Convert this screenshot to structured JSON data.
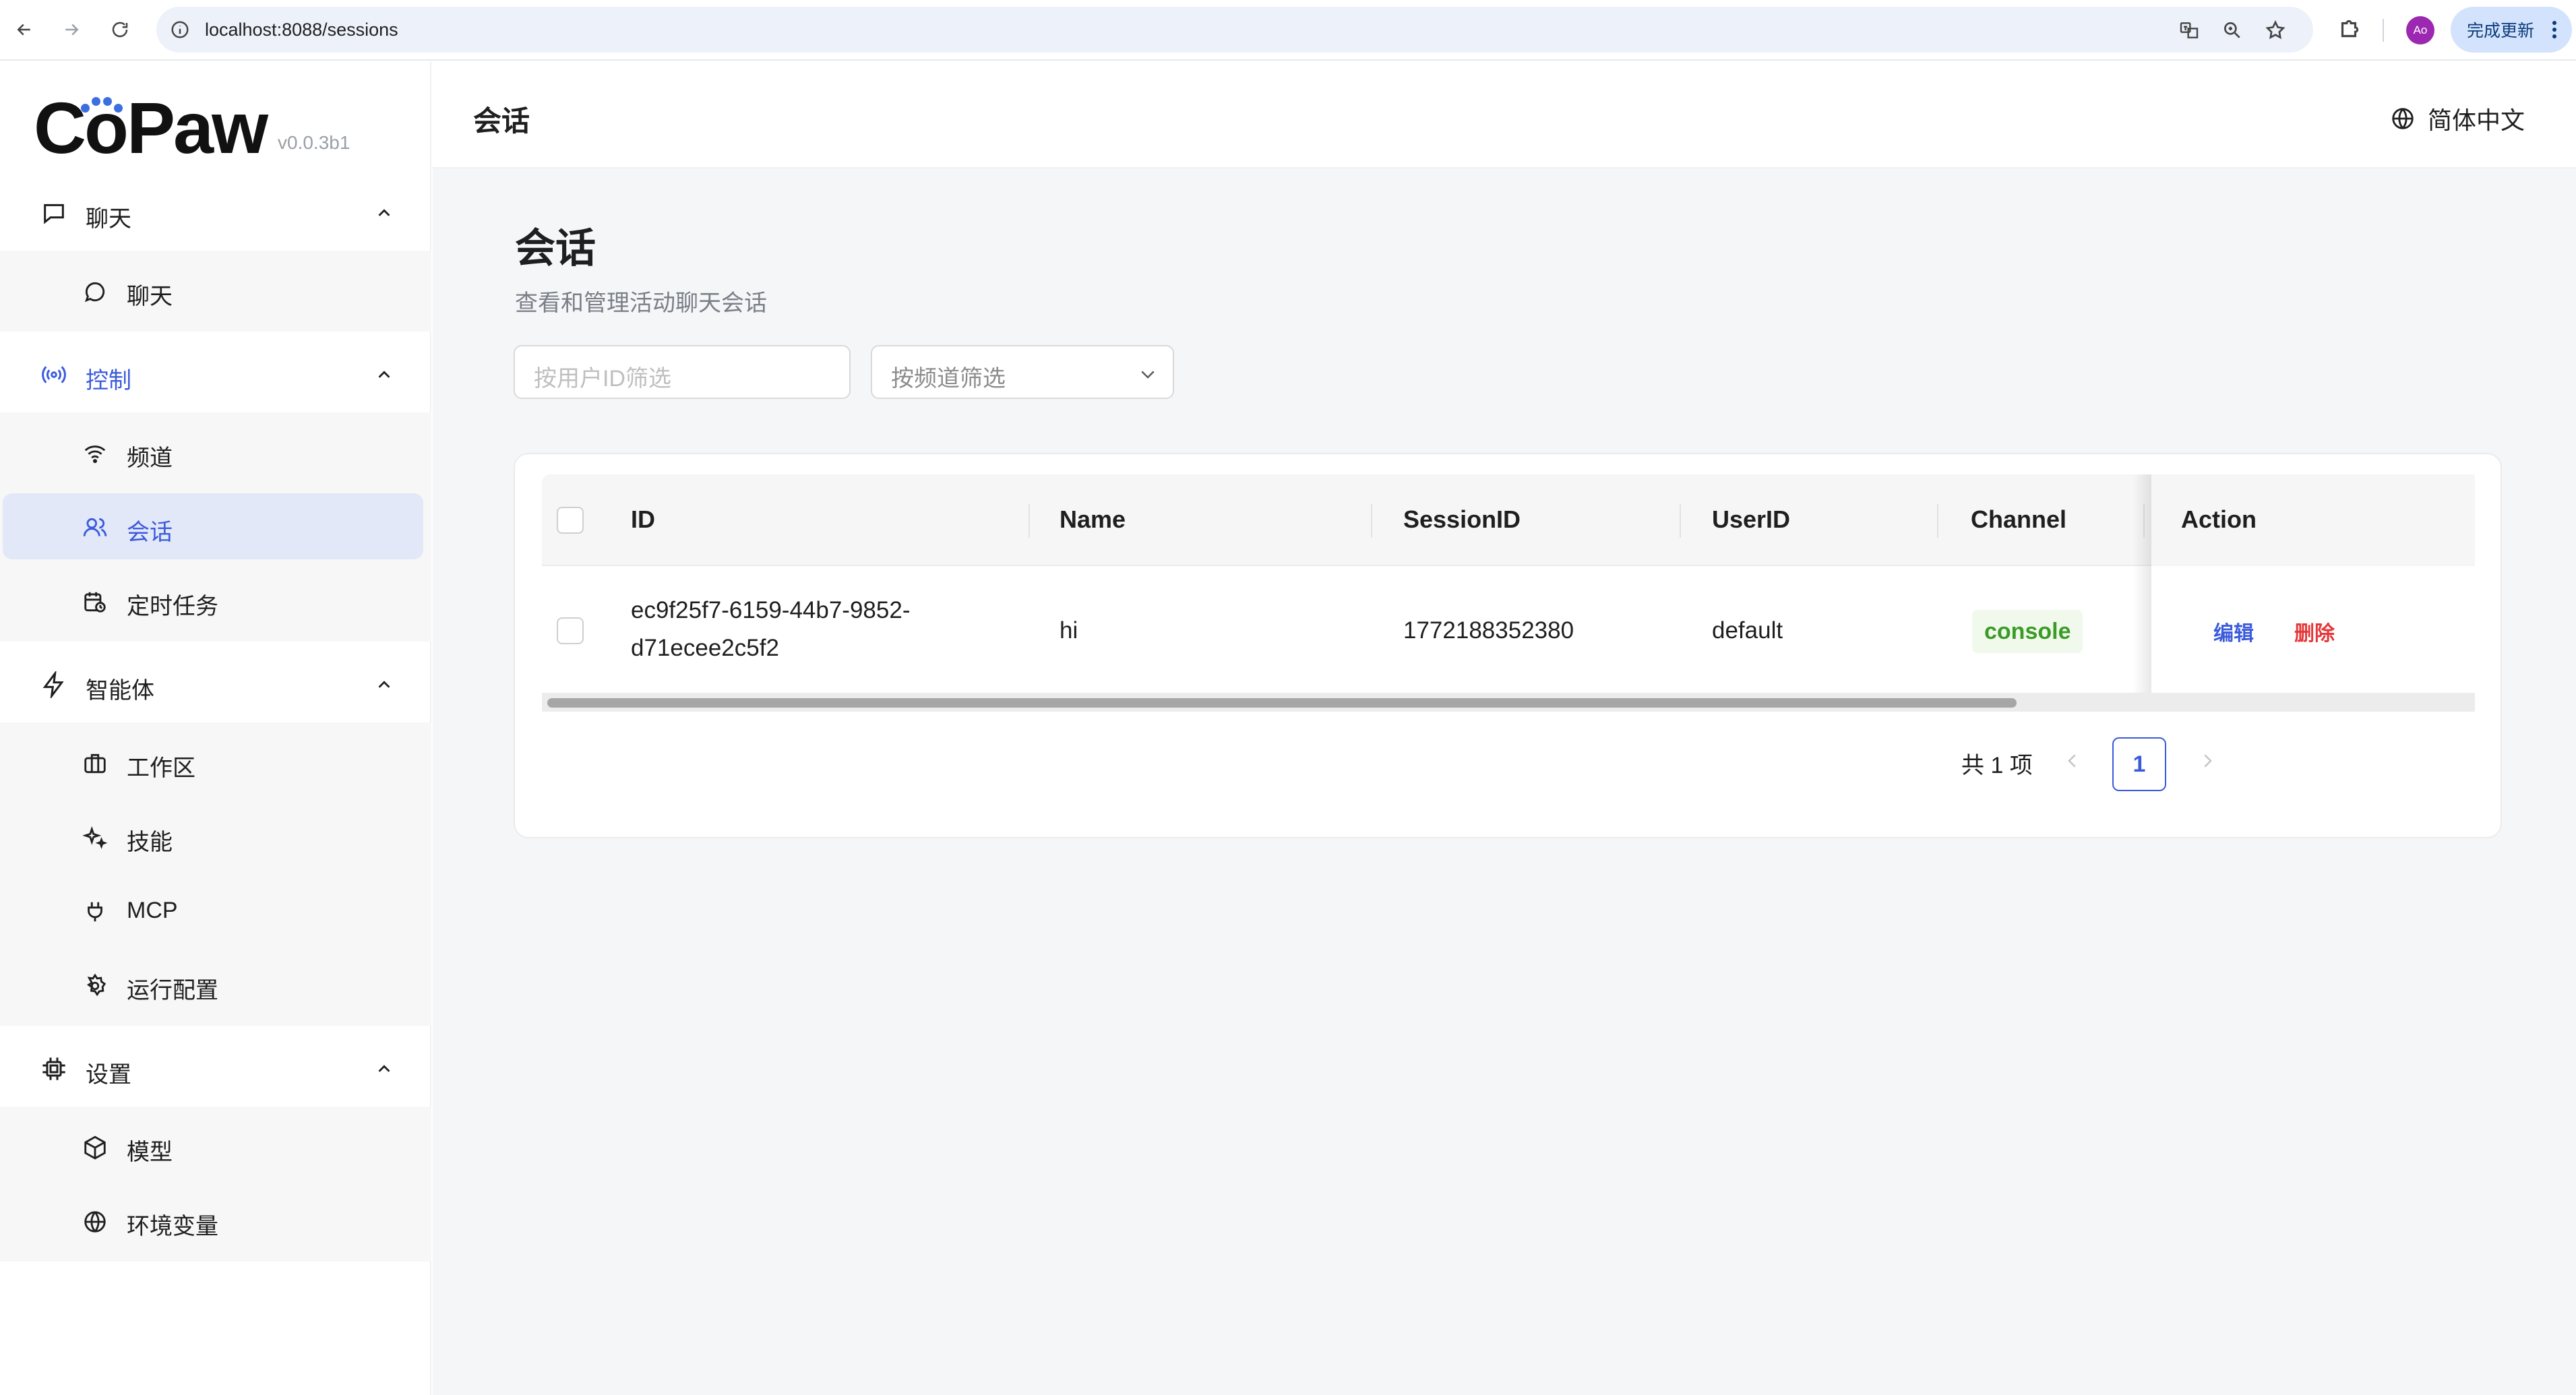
{
  "browser": {
    "url": "localhost:8088/sessions",
    "profile_initials": "Ao",
    "update_label": "完成更新"
  },
  "sidebar": {
    "logo": "CoPaw",
    "version": "v0.0.3b1",
    "groups": [
      {
        "label": "聊天",
        "icon": "chat-bubble-icon",
        "items": [
          {
            "label": "聊天",
            "icon": "message-circle-icon"
          }
        ]
      },
      {
        "label": "控制",
        "icon": "broadcast-icon",
        "active": true,
        "items": [
          {
            "label": "频道",
            "icon": "wifi-icon"
          },
          {
            "label": "会话",
            "icon": "users-icon",
            "selected": true
          },
          {
            "label": "定时任务",
            "icon": "calendar-clock-icon"
          }
        ]
      },
      {
        "label": "智能体",
        "icon": "lightning-icon",
        "items": [
          {
            "label": "工作区",
            "icon": "briefcase-icon"
          },
          {
            "label": "技能",
            "icon": "sparkles-icon"
          },
          {
            "label": "MCP",
            "icon": "plug-icon"
          },
          {
            "label": "运行配置",
            "icon": "gear-icon"
          }
        ]
      },
      {
        "label": "设置",
        "icon": "chip-icon",
        "items": [
          {
            "label": "模型",
            "icon": "cube-icon"
          },
          {
            "label": "环境变量",
            "icon": "globe-icon"
          }
        ]
      }
    ]
  },
  "header": {
    "breadcrumb": "会话",
    "language": "简体中文"
  },
  "page": {
    "title": "会话",
    "description": "查看和管理活动聊天会话",
    "filter_user_placeholder": "按用户ID筛选",
    "filter_channel_placeholder": "按频道筛选"
  },
  "table": {
    "columns": [
      "ID",
      "Name",
      "SessionID",
      "UserID",
      "Channel",
      "Action"
    ],
    "rows": [
      {
        "id_line1": "ec9f25f7-6159-44b7-9852-",
        "id_line2": "d71ecee2c5f2",
        "name": "hi",
        "session_id": "1772188352380",
        "user_id": "default",
        "channel": "console",
        "edit": "编辑",
        "delete": "删除"
      }
    ]
  },
  "pagination": {
    "total_label": "共 1 项",
    "current_page": "1"
  },
  "colors": {
    "accent": "#3b5bdb",
    "danger": "#e5383b",
    "success": "#3a9b27"
  }
}
